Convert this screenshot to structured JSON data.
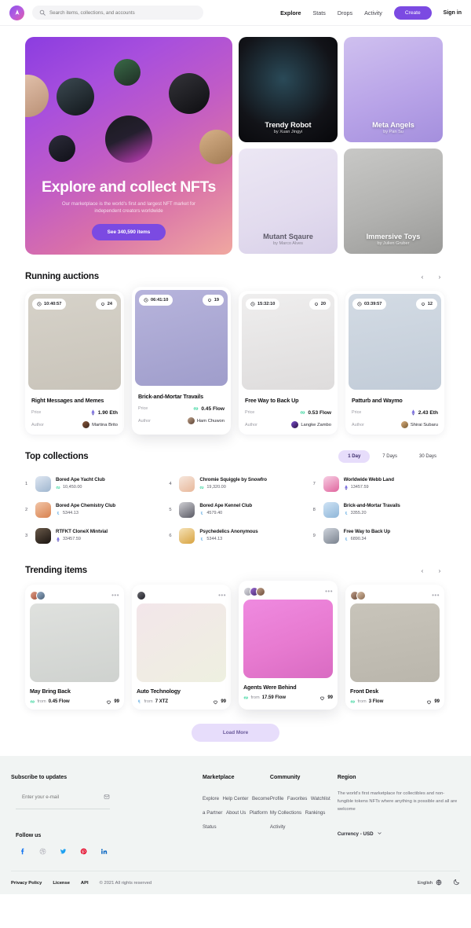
{
  "header": {
    "logo_icon": "logo-mark-icon",
    "search": {
      "placeholder": "Search items, collections, and accounts",
      "value": ""
    },
    "nav": [
      {
        "label": "Explore",
        "active": true
      },
      {
        "label": "Stats",
        "active": false
      },
      {
        "label": "Drops",
        "active": false
      },
      {
        "label": "Activity",
        "active": false
      }
    ],
    "create_label": "Create",
    "signin_label": "Sign in",
    "accent_color": "#7b4ae2"
  },
  "hero": {
    "title": "Explore and collect NFTs",
    "subtitle": "Our marketplace is the world's first and largest NFT market for independent creators worldwide",
    "cta_label": "See 340,590 items",
    "cards": [
      {
        "title": "Trendy Robot",
        "by": "by Xuan Jingyi"
      },
      {
        "title": "Meta Angels",
        "by": "by Pan Su"
      },
      {
        "title": "Mutant Sqaure",
        "by": "by Marco Alves"
      },
      {
        "title": "Immersive Toys",
        "by": "by Julien Gruber"
      }
    ]
  },
  "auctions": {
    "title": "Running auctions",
    "prev_label": "‹",
    "next_label": "›",
    "price_label": "Price",
    "author_label": "Author",
    "items": [
      {
        "timer": "10:40:57",
        "likes": "24",
        "title": "Right Messages and Memes",
        "price": "1.90 Eth",
        "currency": "eth",
        "author": "Martina Brito"
      },
      {
        "timer": "06:41:10",
        "likes": "19",
        "title": "Brick-and-Mortar Travails",
        "price": "0.45 Flow",
        "currency": "flow",
        "author": "Ham Chuwon"
      },
      {
        "timer": "15:32:10",
        "likes": "20",
        "title": "Free Way to Back Up",
        "price": "0.53 Flow",
        "currency": "flow",
        "author": "Langke Zambo"
      },
      {
        "timer": "03:39:57",
        "likes": "12",
        "title": "Patturb and Waymo",
        "price": "2.43 Eth",
        "currency": "eth",
        "author": "Shirai Subaru"
      }
    ]
  },
  "collections": {
    "title": "Top collections",
    "tabs": [
      {
        "label": "1 Day",
        "active": true
      },
      {
        "label": "7 Days",
        "active": false
      },
      {
        "label": "30 Days",
        "active": false
      }
    ],
    "items": [
      {
        "rank": "1",
        "name": "Bored Ape Yacht Club",
        "value": "10,450.00",
        "currency": "flow"
      },
      {
        "rank": "2",
        "name": "Bored Ape Chemistry Club",
        "value": "5344.13",
        "currency": "xtz"
      },
      {
        "rank": "3",
        "name": "RTFKT CloneX Mintvial",
        "value": "33457.59",
        "currency": "eth"
      },
      {
        "rank": "4",
        "name": "Chromie Squiggle by Snowfro",
        "value": "19,320.00",
        "currency": "flow"
      },
      {
        "rank": "5",
        "name": "Bored Ape Kennel Club",
        "value": "4579.40",
        "currency": "xtz"
      },
      {
        "rank": "6",
        "name": "Psychedelics Anonymous",
        "value": "5344.13",
        "currency": "xtz"
      },
      {
        "rank": "7",
        "name": "Worldwide Webb Land",
        "value": "13457.59",
        "currency": "eth"
      },
      {
        "rank": "8",
        "name": "Brick-and-Mortar Travails",
        "value": "3355.20",
        "currency": "xtz"
      },
      {
        "rank": "9",
        "name": "Free Way to Back Up",
        "value": "6890.34",
        "currency": "xtz"
      }
    ]
  },
  "trending": {
    "title": "Trending items",
    "prev_label": "‹",
    "next_label": "›",
    "from_label": "from",
    "menu_label": "•••",
    "items": [
      {
        "title": "May Bring Back",
        "price": "0.45 Flow",
        "currency": "flow",
        "likes": "99",
        "avatars": 2
      },
      {
        "title": "Auto Technology",
        "price": "7 XTZ",
        "currency": "xtz",
        "likes": "99",
        "avatars": 1
      },
      {
        "title": "Agents Were Behind",
        "price": "17.59 Flow",
        "currency": "flow",
        "likes": "99",
        "avatars": 3
      },
      {
        "title": "Front Desk",
        "price": "3 Flow",
        "currency": "flow",
        "likes": "99",
        "avatars": 2
      }
    ]
  },
  "load_more_label": "Load More",
  "footer": {
    "subscribe_title": "Subscribe to updates",
    "email_placeholder": "Enter your e-mail",
    "email_value": "",
    "follow_title": "Follow us",
    "socials": [
      "facebook-icon",
      "dribbble-icon",
      "twitter-icon",
      "pinterest-icon",
      "linkedin-icon"
    ],
    "marketplace_title": "Marketplace",
    "marketplace_links": [
      "Explore",
      "Help Center",
      "Become a Partner",
      "About Us",
      "Platform Status"
    ],
    "community_title": "Community",
    "community_links": [
      "Profile",
      "Favorites",
      "Watchlist",
      "My Collections",
      "Rankings",
      "Activity"
    ],
    "region_title": "Region",
    "region_text": "The world's first marketplace for collectibles and non-fungible tokens NFTs where anything is possible and all are welcome",
    "currency_label": "Currency - USD",
    "bottom_links": [
      "Privacy Policy",
      "License",
      "API"
    ],
    "copyright": "© 2021 All rights reserved",
    "language_label": "English"
  }
}
